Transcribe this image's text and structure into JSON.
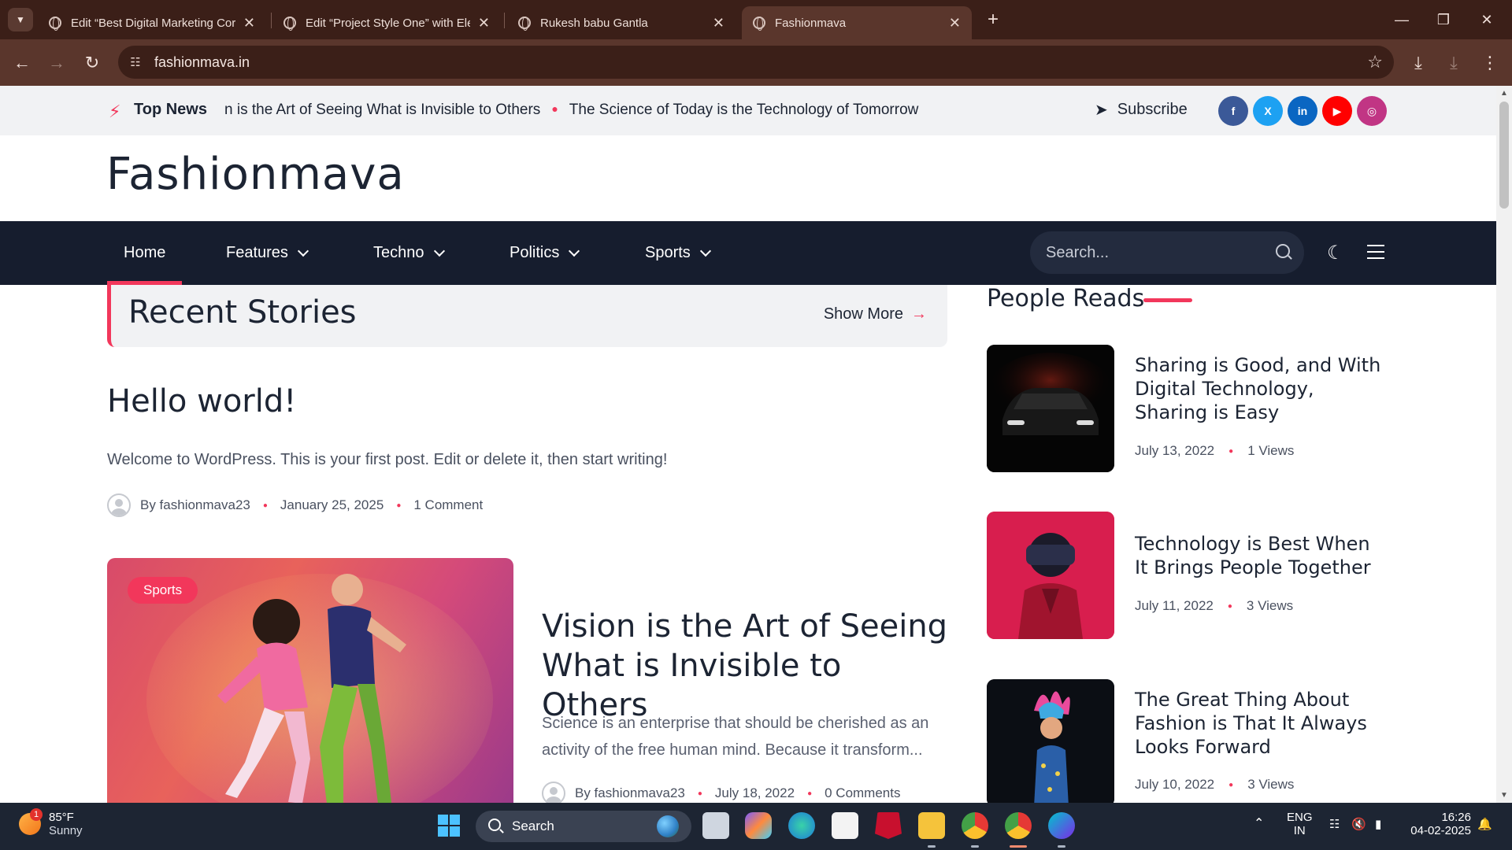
{
  "browser": {
    "tabs": [
      {
        "title": "Edit “Best Digital Marketing Cor"
      },
      {
        "title": "Edit “Project Style One” with Ele"
      },
      {
        "title": "Rukesh babu Gantla"
      },
      {
        "title": "Fashionmava"
      }
    ],
    "url": "fashionmava.in"
  },
  "topbar": {
    "top_news_label": "Top News",
    "ticker": [
      "n is the Art of Seeing What is Invisible to Others",
      "The Science of Today is the Technology of Tomorrow"
    ],
    "subscribe_label": "Subscribe",
    "social": [
      {
        "name": "facebook",
        "glyph": "f",
        "color": "#3b5998"
      },
      {
        "name": "x",
        "glyph": "X",
        "color": "#1da1f2"
      },
      {
        "name": "linkedin",
        "glyph": "in",
        "color": "#0a66c2"
      },
      {
        "name": "youtube",
        "glyph": "▶",
        "color": "#ff0000"
      },
      {
        "name": "instagram",
        "glyph": "◎",
        "color": "#c13584"
      }
    ]
  },
  "site": {
    "brand": "Fashionmava"
  },
  "nav": {
    "items": [
      "Home",
      "Features",
      "Techno",
      "Politics",
      "Sports"
    ],
    "search_placeholder": "Search..."
  },
  "recent": {
    "title": "Recent Stories",
    "show_more": "Show More"
  },
  "posts": [
    {
      "title": "Hello world!",
      "excerpt": "Welcome to WordPress. This is your first post. Edit or delete it, then start writing!",
      "author": "By fashionmava23",
      "date": "January 25, 2025",
      "comments": "1 Comment"
    },
    {
      "badge": "Sports",
      "title": "Vision is the Art of Seeing What is Invisible to Others",
      "excerpt": "Science is an enterprise that should be cherished as an activity of the free human mind. Because it transform...",
      "author": "By fashionmava23",
      "date": "July 18, 2022",
      "comments": "0 Comments"
    }
  ],
  "people_reads": {
    "title": "People Reads",
    "items": [
      {
        "title": "Sharing is Good, and With Digital Technology, Sharing is Easy",
        "date": "July 13, 2022",
        "views": "1 Views"
      },
      {
        "title": "Technology is Best When It Brings People Together",
        "date": "July 11, 2022",
        "views": "3 Views"
      },
      {
        "title": "The Great Thing About Fashion is That It Always Looks Forward",
        "date": "July 10, 2022",
        "views": "3 Views"
      }
    ]
  },
  "taskbar": {
    "weather_temp": "85°F",
    "weather_desc": "Sunny",
    "weather_badge": "1",
    "search_label": "Search",
    "lang": "ENG",
    "region": "IN",
    "time": "16:26",
    "date": "04-02-2025"
  }
}
